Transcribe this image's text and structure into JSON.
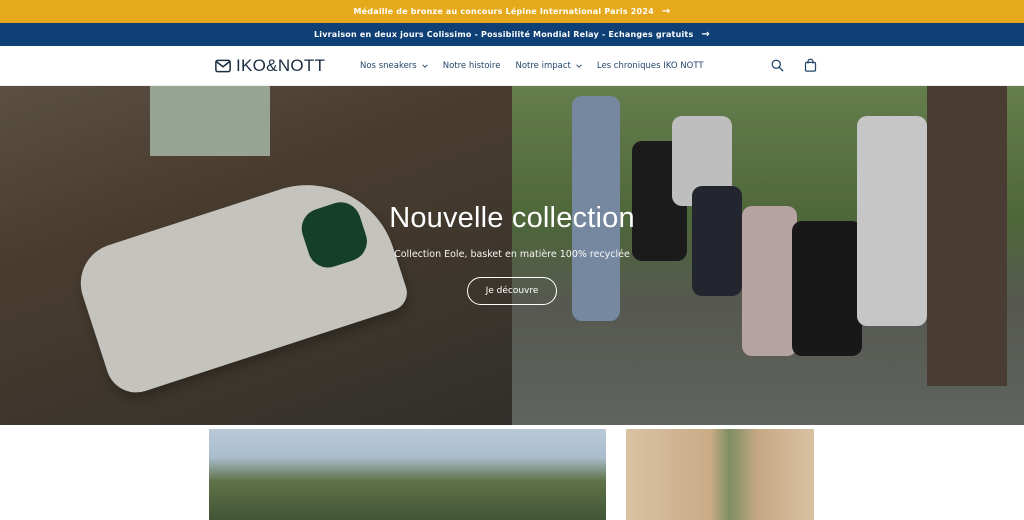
{
  "announcements": [
    {
      "text": "Médaille de bronze au concours Lépine International Paris 2024",
      "arrow": "→"
    },
    {
      "text": "Livraison en deux jours Colissimo - Possibilité Mondial Relay - Echanges gratuits",
      "arrow": "→"
    }
  ],
  "header": {
    "logo_text": "IKO&NOTT",
    "nav": [
      {
        "label": "Nos sneakers"
      },
      {
        "label": "Notre histoire"
      },
      {
        "label": "Notre impact"
      },
      {
        "label": "Les chroniques IKO NOTT"
      }
    ],
    "icons": [
      "search-icon",
      "cart-icon"
    ]
  },
  "hero": {
    "title": "Nouvelle collection",
    "subtitle": "Collection Eole, basket en matière 100% recyclée",
    "button": "Je découvre"
  },
  "colors": {
    "gold_bar": "#e7a91c",
    "blue_bar": "#0e3f75",
    "brand_text": "#1b2d40",
    "nav_text": "#24466b"
  }
}
